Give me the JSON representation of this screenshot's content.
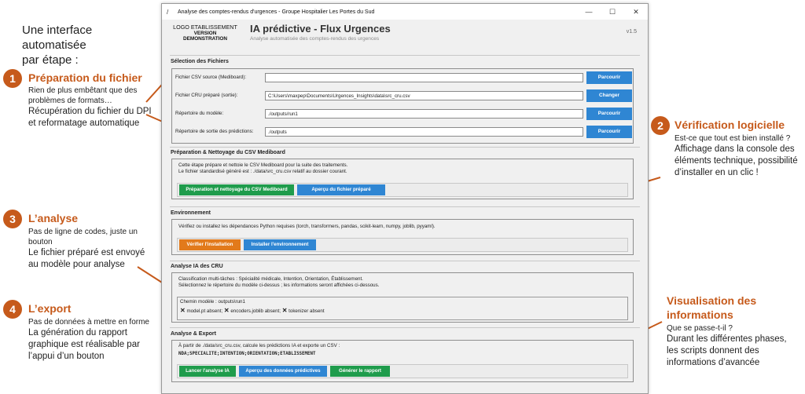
{
  "intro": {
    "line1": "Une interface automatisée",
    "line2": "par étape :"
  },
  "annotations": {
    "a1": {
      "num": "1",
      "title": "Préparation du fichier",
      "lines": [
        "Rien de plus embêtant que des",
        "problèmes de formats…"
      ],
      "big": [
        "Récupération du fichier du DPI",
        "et reformatage automatique"
      ]
    },
    "a2": {
      "num": "2",
      "title": "Vérification logicielle",
      "lines": [
        "Est-ce que tout est bien installé ?",
        "Affichage dans la console des",
        "éléments technique, possibilité",
        "d’installer en un clic !"
      ]
    },
    "a3": {
      "num": "3",
      "title": "L’analyse",
      "lines": [
        "Pas de ligne de codes, juste un",
        "bouton"
      ],
      "big": [
        "Le fichier préparé est envoyé",
        "au modèle pour analyse"
      ]
    },
    "a4": {
      "num": "4",
      "title": "L’export",
      "lines": [
        "Pas de données à mettre en forme"
      ],
      "big": [
        "La génération du rapport",
        "graphique est réalisable par",
        "l’appui d’un bouton"
      ]
    },
    "a5": {
      "title1": "Visualisation des",
      "title2": "informations",
      "lines": [
        "Que se passe-t-il ?"
      ],
      "big": [
        "Durant les différentes phases,",
        "les scripts donnent des",
        "informations d’avancée"
      ]
    }
  },
  "window": {
    "title": "Analyse des comptes-rendus d'urgences - Groupe Hospitalier Les Portes du Sud",
    "controls": {
      "minimize": "—",
      "maximize": "☐",
      "close": "✕"
    },
    "logo": {
      "l1": "LOGO ETABLISSEMENT",
      "l2": "VERSION",
      "l3": "DEMONSTRATION"
    },
    "app_title": "IA prédictive - Flux Urgences",
    "app_subtitle": "Analyse automatisée des comptes-rendus des urgences",
    "version": "v1.5"
  },
  "files": {
    "section": "Sélection des Fichiers",
    "rows": [
      {
        "label": "Fichier CSV source (Mediboard):",
        "value": "",
        "button": "Parcourir"
      },
      {
        "label": "Fichier CRU préparé (sortie):",
        "value": "C:\\Users\\maxpep\\Documents\\Urgences_Insights\\data\\src_cru.csv",
        "button": "Changer"
      },
      {
        "label": "Répertoire du modèle:",
        "value": "./outputs/run1",
        "button": "Parcourir"
      },
      {
        "label": "Répertoire de sortie des prédictions:",
        "value": "./outputs",
        "button": "Parcourir"
      }
    ]
  },
  "prep": {
    "section": "Préparation & Nettoyage du CSV Mediboard",
    "line1": "Cette étape prépare et nettoie le CSV Mediboard pour la suite des traitements.",
    "line2": "Le fichier standardisé généré est : ./data/src_cru.csv relatif au dossier courant.",
    "btn1": "Préparation et nettoyage du CSV Mediboard",
    "btn2": "Aperçu du fichier préparé"
  },
  "env": {
    "section": "Environnement",
    "line1": "Vérifiez ou installez les dépendances Python requises (torch, transformers, pandas, scikit-learn, numpy, joblib, pyyaml).",
    "btn1": "Vérifier l'installation",
    "btn2": "Installer l'environnement"
  },
  "analyse": {
    "section": "Analyse IA des CRU",
    "line1": "Classification multi-tâches : Spécialité médicale, Intention, Orientation, Établissement.",
    "line2": "Sélectionnez le répertoire du modèle ci-dessus ; les informations seront affichées ci-dessous.",
    "model_path": "Chemin modèle : outputs\\run1",
    "status": [
      "model.pt absent;",
      "encoders.joblib absent;",
      "tokenizer absent"
    ]
  },
  "export": {
    "section": "Analyse & Export",
    "line1": "À partir de ./data/src_cru.csv, calcule les prédictions IA et exporte un CSV :",
    "columns": "NDA;SPECIALITE;INTENTION;ORIENTATION;ETABLISSEMENT",
    "btn1": "Lancer l'analyse IA",
    "btn2": "Aperçu des données prédictives",
    "btn3": "Générer le rapport"
  }
}
